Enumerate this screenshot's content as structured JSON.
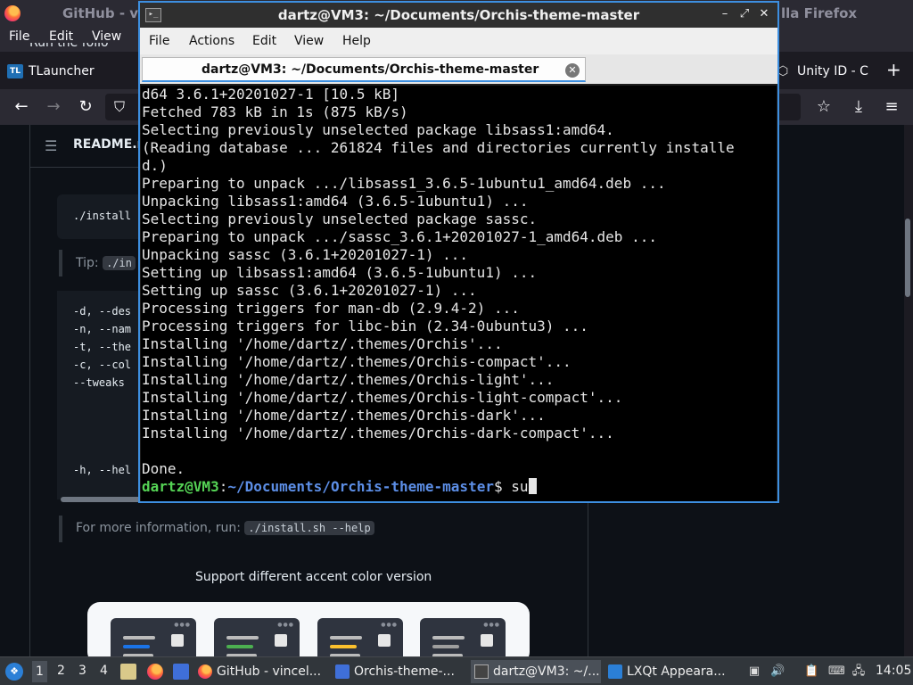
{
  "firefox": {
    "title_left": "GitHub - v",
    "title_right": "lla Firefox",
    "menu": [
      "File",
      "Edit",
      "View"
    ],
    "tabs": {
      "tlauncher": "TLauncher",
      "tl_badge": "TL",
      "unity": "Unity ID - C"
    },
    "nav_icons": [
      "back-icon",
      "forward-icon",
      "reload-icon",
      "shield-icon",
      "bookmark-star-icon",
      "download-icon",
      "menu-icon"
    ]
  },
  "github": {
    "readme_title": "README.m",
    "run_text": "Run the follo",
    "install_cmd": "./install",
    "tip_label": "Tip:",
    "tip_code": "./in",
    "options": [
      "-d, --des",
      "-n, --nam",
      "-t, --the",
      "-c, --col",
      "--tweaks",
      "-h, --hel"
    ],
    "more_info": "For more information, run:",
    "more_info_code": "./install.sh --help",
    "caption": "Support different accent color version",
    "accent_colors": [
      "#1a73e8",
      "#4caf50",
      "#fbc02d",
      "#9e9e9e"
    ]
  },
  "terminal": {
    "title": "dartz@VM3: ~/Documents/Orchis-theme-master",
    "menu": [
      "File",
      "Actions",
      "Edit",
      "View",
      "Help"
    ],
    "tab_label": "dartz@VM3: ~/Documents/Orchis-theme-master",
    "window_buttons": [
      "minimize-icon",
      "maximize-icon",
      "close-icon"
    ],
    "lines": [
      "d64 3.6.1+20201027-1 [10.5 kB]",
      "Fetched 783 kB in 1s (875 kB/s)",
      "Selecting previously unselected package libsass1:amd64.",
      "(Reading database ... 261824 files and directories currently installe",
      "d.)",
      "Preparing to unpack .../libsass1_3.6.5-1ubuntu1_amd64.deb ...",
      "Unpacking libsass1:amd64 (3.6.5-1ubuntu1) ...",
      "Selecting previously unselected package sassc.",
      "Preparing to unpack .../sassc_3.6.1+20201027-1_amd64.deb ...",
      "Unpacking sassc (3.6.1+20201027-1) ...",
      "Setting up libsass1:amd64 (3.6.5-1ubuntu1) ...",
      "Setting up sassc (3.6.1+20201027-1) ...",
      "Processing triggers for man-db (2.9.4-2) ...",
      "Processing triggers for libc-bin (2.34-0ubuntu3) ...",
      "Installing '/home/dartz/.themes/Orchis'...",
      "Installing '/home/dartz/.themes/Orchis-compact'...",
      "Installing '/home/dartz/.themes/Orchis-light'...",
      "Installing '/home/dartz/.themes/Orchis-light-compact'...",
      "Installing '/home/dartz/.themes/Orchis-dark'...",
      "Installing '/home/dartz/.themes/Orchis-dark-compact'...",
      "",
      "Done."
    ],
    "prompt": {
      "user": "dartz@VM3",
      "sep": ":",
      "path": "~/Documents/Orchis-theme-master",
      "symbol": "$ ",
      "input": "su"
    }
  },
  "taskbar": {
    "workspaces": [
      "1",
      "2",
      "3",
      "4"
    ],
    "active_workspace": "1",
    "tasks": [
      {
        "label": "GitHub - vincel...",
        "icon": "firefox-icon"
      },
      {
        "label": "Orchis-theme-...",
        "icon": "folder-icon"
      },
      {
        "label": "dartz@VM3: ~/...",
        "icon": "terminal-icon"
      },
      {
        "label": "LXQt Appeara...",
        "icon": "appearance-icon"
      }
    ],
    "clock": "14:05"
  }
}
